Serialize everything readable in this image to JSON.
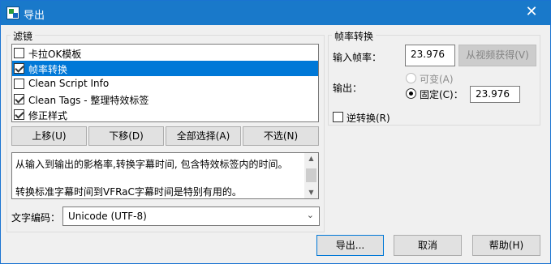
{
  "window": {
    "title": "导出",
    "close_glyph": "✕"
  },
  "filters": {
    "label": "滤镜",
    "items": [
      {
        "label": "卡拉OK模板",
        "checked": false,
        "selected": false
      },
      {
        "label": "帧率转换",
        "checked": true,
        "selected": true
      },
      {
        "label": "Clean Script Info",
        "checked": false,
        "selected": false
      },
      {
        "label": "Clean Tags - 整理特效标签",
        "checked": true,
        "selected": false
      },
      {
        "label": "修正样式",
        "checked": true,
        "selected": false
      }
    ],
    "buttons": {
      "move_up": "上移(U)",
      "move_down": "下移(D)",
      "select_all": "全部选择(A)",
      "select_none": "不选(N)"
    },
    "description_lines": [
      "从输入到输出的影格率,转换字幕时间, 包含特效标签内的时间。",
      "",
      "转换标准字幕时间到VFRaC字幕时间是特别有用的。"
    ],
    "scroll": {
      "up_glyph": "▲",
      "down_glyph": "▼"
    }
  },
  "encoding": {
    "label": "文字编码：",
    "value": "Unicode (UTF-8)",
    "arrow_glyph": "⌄"
  },
  "framerate": {
    "group_label": "帧率转换",
    "input_label": "输入帧率：",
    "input_value": "23.976",
    "from_video_button": "从视频获得(V)",
    "output_label": "输出：",
    "variable_label": "可变(A)",
    "fixed_label": "固定(C)：",
    "fixed_value": "23.976",
    "reverse_label": "逆转换(R)"
  },
  "footer": {
    "export_button": "导出...",
    "cancel_button": "取消",
    "help_button": "帮助(H)"
  },
  "colors": {
    "titlebar": "#1979ca",
    "selection": "#0078d7"
  }
}
